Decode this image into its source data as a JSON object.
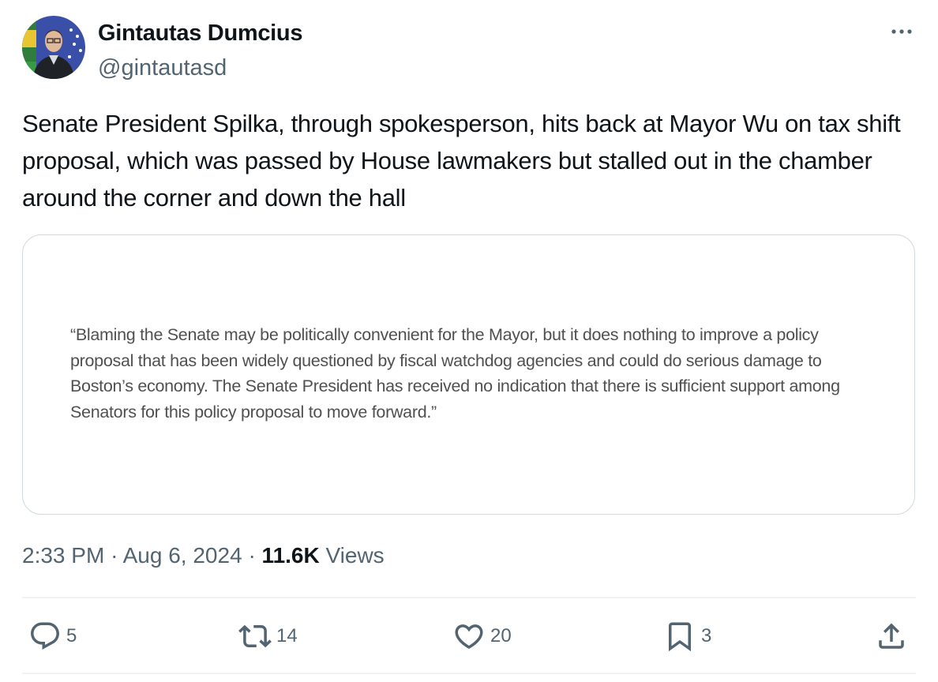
{
  "author": {
    "display_name": "Gintautas Dumcius",
    "handle": "@gintautasd"
  },
  "tweet": {
    "text": "Senate President Spilka, through spokesperson, hits back at Mayor Wu on tax shift proposal, which was passed by House lawmakers but stalled out in the chamber around the corner and down the hall",
    "image_quote": "“Blaming the Senate may be politically convenient for the Mayor, but it does nothing to improve a policy proposal that has been widely questioned by fiscal watchdog agencies and could do serious damage to Boston’s economy. The Senate President has received no indication that there is sufficient support among Senators for this policy proposal to move forward.”"
  },
  "meta": {
    "time": "2:33 PM",
    "separator": "·",
    "date": "Aug 6, 2024",
    "views_count": "11.6K",
    "views_label": "Views"
  },
  "actions": {
    "replies": "5",
    "reposts": "14",
    "likes": "20",
    "bookmarks": "3"
  },
  "icons": {
    "more": "more-horizontal-icon",
    "reply": "reply-icon",
    "repost": "repost-icon",
    "like": "heart-icon",
    "bookmark": "bookmark-icon",
    "share": "share-icon"
  },
  "colors": {
    "text_primary": "#0f1419",
    "text_secondary": "#536471",
    "border": "#cfd9de",
    "divider": "#eff3f4"
  }
}
